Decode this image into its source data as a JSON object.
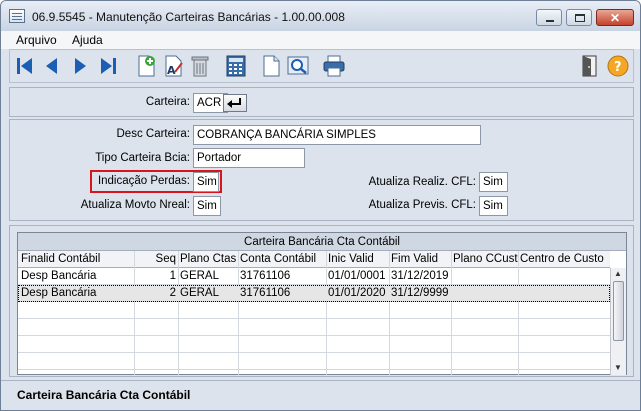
{
  "window": {
    "title": "06.9.5545 - Manutenção Carteiras Bancárias - 1.00.00.008"
  },
  "menu": {
    "items": [
      {
        "label": "Arquivo"
      },
      {
        "label": "Ajuda"
      }
    ]
  },
  "toolbar": {
    "icons": [
      "first-record-icon",
      "previous-record-icon",
      "next-record-icon",
      "last-record-icon",
      "new-record-icon",
      "edit-record-icon",
      "delete-record-icon",
      "calculator-icon",
      "blank-document-icon",
      "zoom-search-icon",
      "print-icon",
      "exit-door-icon",
      "help-icon"
    ]
  },
  "header": {
    "carteira_label": "Carteira:",
    "carteira_value": "ACR"
  },
  "form": {
    "desc_label": "Desc Carteira:",
    "desc_value": "COBRANÇA BANCÁRIA SIMPLES",
    "tipo_label": "Tipo Carteira Bcia:",
    "tipo_value": "Portador",
    "indicacao_label": "Indicação Perdas:",
    "indicacao_value": "Sim",
    "movto_label": "Atualiza Movto Nreal:",
    "movto_value": "Sim",
    "realiz_label": "Atualiza Realiz. CFL:",
    "realiz_value": "Sim",
    "previs_label": "Atualiza Previs. CFL:",
    "previs_value": "Sim"
  },
  "grid": {
    "title": "Carteira Bancária Cta Contábil",
    "columns": [
      "Finalid Contábil",
      "Seq",
      "Plano Ctas",
      "Conta Contábil",
      "Inic Valid",
      "Fim Valid",
      "Plano CCusto",
      "Centro de Custo"
    ],
    "rows": [
      [
        "Desp Bancária",
        "1",
        "GERAL",
        "31761106",
        "01/01/0001",
        "31/12/2019",
        "",
        ""
      ],
      [
        "Desp Bancária",
        "2",
        "GERAL",
        "31761106",
        "01/01/2020",
        "31/12/9999",
        "",
        ""
      ]
    ]
  },
  "status": {
    "text": "Carteira Bancária Cta Contábil"
  },
  "colors": {
    "highlight": "#d8141c",
    "toolbar_blue": "#1a5fb4"
  }
}
